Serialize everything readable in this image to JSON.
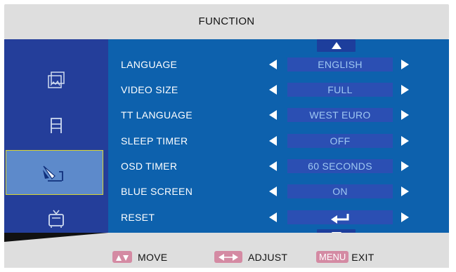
{
  "header": {
    "title": "FUNCTION"
  },
  "sidebar": {
    "items": [
      {
        "name": "picture-icon",
        "active": false
      },
      {
        "name": "sound-icon",
        "active": false
      },
      {
        "name": "function-icon",
        "active": true
      },
      {
        "name": "tv-icon",
        "active": false
      }
    ]
  },
  "menu": {
    "rows": [
      {
        "label": "LANGUAGE",
        "value": "ENGLISH"
      },
      {
        "label": "VIDEO SIZE",
        "value": "FULL"
      },
      {
        "label": "TT LANGUAGE",
        "value": "WEST EURO"
      },
      {
        "label": "SLEEP TIMER",
        "value": "OFF"
      },
      {
        "label": "OSD TIMER",
        "value": "60 SECONDS"
      },
      {
        "label": "BLUE SCREEN",
        "value": "ON"
      },
      {
        "label": "RESET",
        "value": "",
        "value_icon": "enter-return-icon"
      }
    ]
  },
  "footer": {
    "move_label": "MOVE",
    "adjust_label": "ADJUST",
    "menu_key": "MENU",
    "exit_label": "EXIT"
  },
  "colors": {
    "header_bg": "#dedede",
    "sidebar_bg": "#243e9a",
    "content_bg": "#0d61ad",
    "value_box_bg": "#2b4fb3",
    "value_text": "#9fc8f2",
    "active_tab_bg": "#5d8acb",
    "active_tab_border": "#d9d533",
    "key_badge": "#d48aa3"
  }
}
